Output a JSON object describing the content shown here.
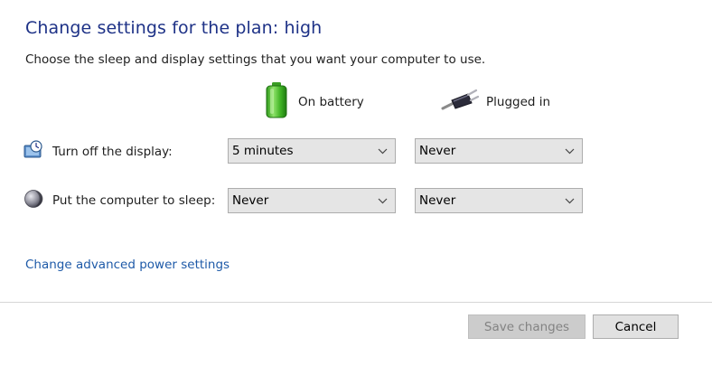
{
  "header": {
    "title": "Change settings for the plan: high",
    "subtitle": "Choose the sleep and display settings that you want your computer to use."
  },
  "columns": {
    "battery": {
      "label": "On battery",
      "icon": "battery-icon"
    },
    "plugged": {
      "label": "Plugged in",
      "icon": "power-plug-icon"
    }
  },
  "rows": [
    {
      "label": "Turn off the display:",
      "icon": "display-clock-icon",
      "battery_value": "5 minutes",
      "plugged_value": "Never"
    },
    {
      "label": "Put the computer to sleep:",
      "icon": "sleep-moon-icon",
      "battery_value": "Never",
      "plugged_value": "Never"
    }
  ],
  "advanced_link": "Change advanced power settings",
  "buttons": {
    "save": {
      "label": "Save changes",
      "enabled": false
    },
    "cancel": {
      "label": "Cancel",
      "enabled": true
    }
  },
  "colors": {
    "title": "#1e3287",
    "link": "#1e5aa8",
    "dropdown_bg": "#e5e5e5",
    "disabled_button_bg": "#cccccc"
  }
}
